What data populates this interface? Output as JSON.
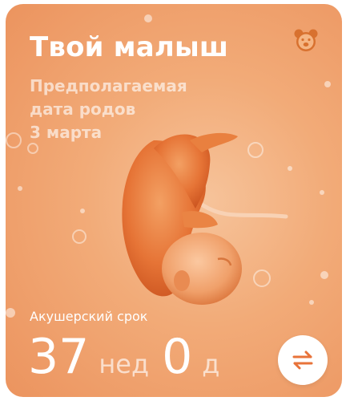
{
  "card": {
    "title": "Твой малыш",
    "due_date_lines": [
      "Предполагаемая",
      "дата родов",
      "3 марта"
    ],
    "term_label": "Акушерский срок",
    "weeks_value": "37",
    "weeks_unit": "нед",
    "days_value": "0",
    "days_unit": "д"
  },
  "icons": {
    "bear": "bear-icon",
    "swap": "swap-arrows-icon",
    "illustration": "fetus-illustration"
  },
  "colors": {
    "background_light": "#f6c39a",
    "background_dark": "#ec9560",
    "accent": "#e8733a",
    "text": "#ffffff"
  }
}
